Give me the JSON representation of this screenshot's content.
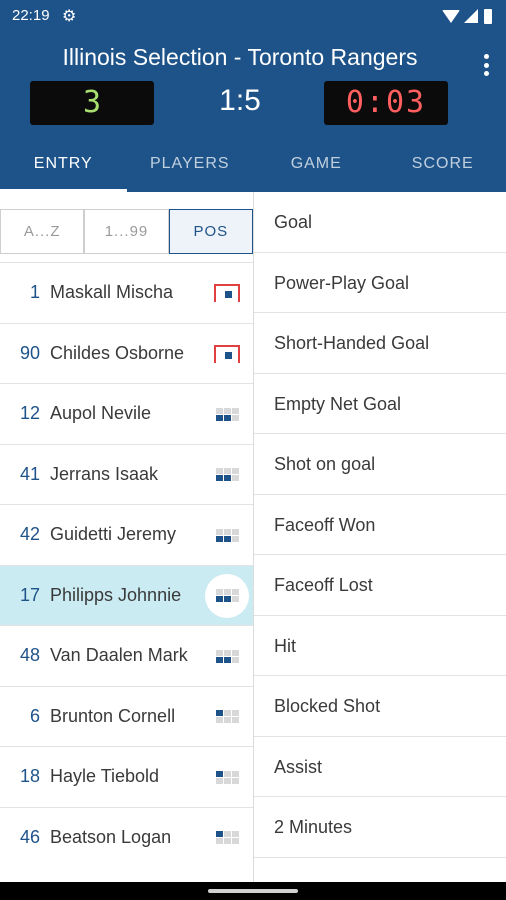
{
  "status_bar": {
    "time": "22:19",
    "icons": [
      "gear-icon",
      "wifi-icon",
      "signal-icon",
      "battery-icon"
    ]
  },
  "header": {
    "title": "Illinois Selection - Toronto Rangers",
    "period": "3",
    "score": "1:5",
    "timer": "0:03",
    "colors": {
      "bar": "#1e5389",
      "period_digit": "#a8e06f",
      "timer_digit": "#ff5f5f"
    }
  },
  "tabs": [
    {
      "label": "ENTRY",
      "active": true
    },
    {
      "label": "PLAYERS",
      "active": false
    },
    {
      "label": "GAME",
      "active": false
    },
    {
      "label": "SCORE",
      "active": false
    }
  ],
  "sort": [
    {
      "label": "A...Z",
      "active": false
    },
    {
      "label": "1...99",
      "active": false
    },
    {
      "label": "POS",
      "active": true
    }
  ],
  "players": [
    {
      "number": "1",
      "name": "Maskall Mischa",
      "position": "goalie"
    },
    {
      "number": "90",
      "name": "Childes Osborne",
      "position": "goalie"
    },
    {
      "number": "12",
      "name": "Aupol Nevile",
      "position": "forward"
    },
    {
      "number": "41",
      "name": "Jerrans Isaak",
      "position": "forward"
    },
    {
      "number": "42",
      "name": "Guidetti Jeremy",
      "position": "forward"
    },
    {
      "number": "17",
      "name": "Philipps Johnnie",
      "position": "forward",
      "selected": true
    },
    {
      "number": "48",
      "name": "Van Daalen Mark",
      "position": "forward"
    },
    {
      "number": "6",
      "name": "Brunton Cornell",
      "position": "defense"
    },
    {
      "number": "18",
      "name": "Hayle Tiebold",
      "position": "defense"
    },
    {
      "number": "46",
      "name": "Beatson Logan",
      "position": "defense"
    }
  ],
  "events": [
    "Goal",
    "Power-Play Goal",
    "Short-Handed Goal",
    "Empty Net Goal",
    "Shot on goal",
    "Faceoff Won",
    "Faceoff Lost",
    "Hit",
    "Blocked Shot",
    "Assist",
    "2 Minutes"
  ]
}
